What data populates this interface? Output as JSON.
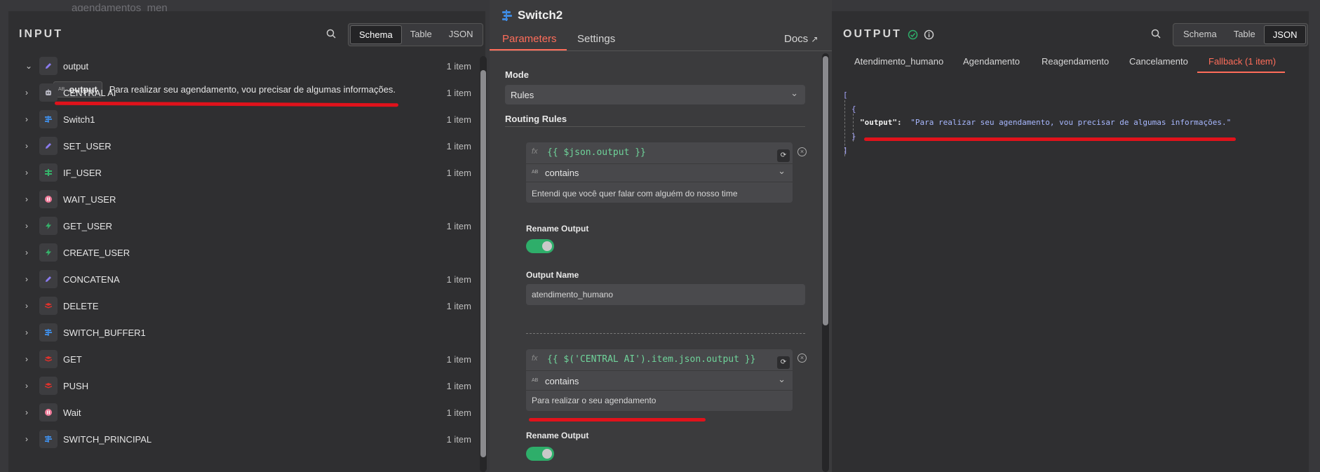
{
  "background": {
    "canvas_text": "agendamentos_men"
  },
  "input": {
    "title": "INPUT",
    "views": [
      "Schema",
      "Table",
      "JSON"
    ],
    "active_view": "Schema",
    "expanded": {
      "label": "output",
      "count": "1 item",
      "field_type": "AB",
      "field_name": "output",
      "field_value": "Para realizar seu agendamento, vou precisar de algumas informações."
    },
    "nodes": [
      {
        "label": "CENTRAL AI",
        "count": "1 item",
        "icon": "robot-icon",
        "color": "#b8b8c4"
      },
      {
        "label": "Switch1",
        "count": "1 item",
        "icon": "switch-icon",
        "color": "#3f8ae0"
      },
      {
        "label": "SET_USER",
        "count": "1 item",
        "icon": "pencil-icon",
        "color": "#8b7bf0"
      },
      {
        "label": "IF_USER",
        "count": "1 item",
        "icon": "if-icon",
        "color": "#35b36a"
      },
      {
        "label": "WAIT_USER",
        "count": "",
        "icon": "pause-icon",
        "color": "#f07b9a"
      },
      {
        "label": "GET_USER",
        "count": "1 item",
        "icon": "bolt-icon",
        "color": "#35b36a"
      },
      {
        "label": "CREATE_USER",
        "count": "",
        "icon": "bolt-icon",
        "color": "#35b36a"
      },
      {
        "label": "CONCATENA",
        "count": "1 item",
        "icon": "pencil-icon",
        "color": "#8b7bf0"
      },
      {
        "label": "DELETE",
        "count": "1 item",
        "icon": "redis-icon",
        "color": "#e0312b"
      },
      {
        "label": "SWITCH_BUFFER1",
        "count": "",
        "icon": "switch-icon",
        "color": "#3f8ae0"
      },
      {
        "label": "GET",
        "count": "1 item",
        "icon": "redis-icon",
        "color": "#e0312b"
      },
      {
        "label": "PUSH",
        "count": "1 item",
        "icon": "redis-icon",
        "color": "#e0312b"
      },
      {
        "label": "Wait",
        "count": "1 item",
        "icon": "pause-icon",
        "color": "#f07b9a"
      },
      {
        "label": "SWITCH_PRINCIPAL",
        "count": "1 item",
        "icon": "switch-icon",
        "color": "#3f8ae0"
      }
    ]
  },
  "middle": {
    "node_title": "Switch2",
    "tabs": [
      "Parameters",
      "Settings"
    ],
    "active_tab": "Parameters",
    "docs": "Docs",
    "mode_label": "Mode",
    "mode_value": "Rules",
    "routing_label": "Routing Rules",
    "rule1": {
      "fx": "fx",
      "expression": "{{ $json.output }}",
      "type_badge": "AB",
      "operator": "contains",
      "value": "Entendi que você quer falar com alguém do nosso time"
    },
    "rename_label": "Rename Output",
    "output_name_label": "Output Name",
    "output_name_value": "atendimento_humano",
    "rule2": {
      "fx": "fx",
      "expression": "{{ $('CENTRAL AI').item.json.output }}",
      "type_badge": "AB",
      "operator": "contains",
      "value": "Para realizar o seu agendamento"
    },
    "rename_label2": "Rename Output"
  },
  "output": {
    "title": "OUTPUT",
    "views": [
      "Schema",
      "Table",
      "JSON"
    ],
    "active_view": "JSON",
    "branches": [
      "Atendimento_humano",
      "Agendamento",
      "Reagendamento",
      "Cancelamento",
      "Fallback (1 item)"
    ],
    "active_branch": "Fallback (1 item)",
    "json": {
      "open_bracket": "[",
      "open_brace": "{",
      "key": "\"output\":",
      "value": "\"Para realizar seu agendamento, vou precisar de algumas informações.\"",
      "close_brace": "}",
      "close_bracket": "]"
    }
  },
  "colors": {
    "accent": "#ff6d5a",
    "success": "#2eae6a",
    "annotation": "#e0121b"
  }
}
